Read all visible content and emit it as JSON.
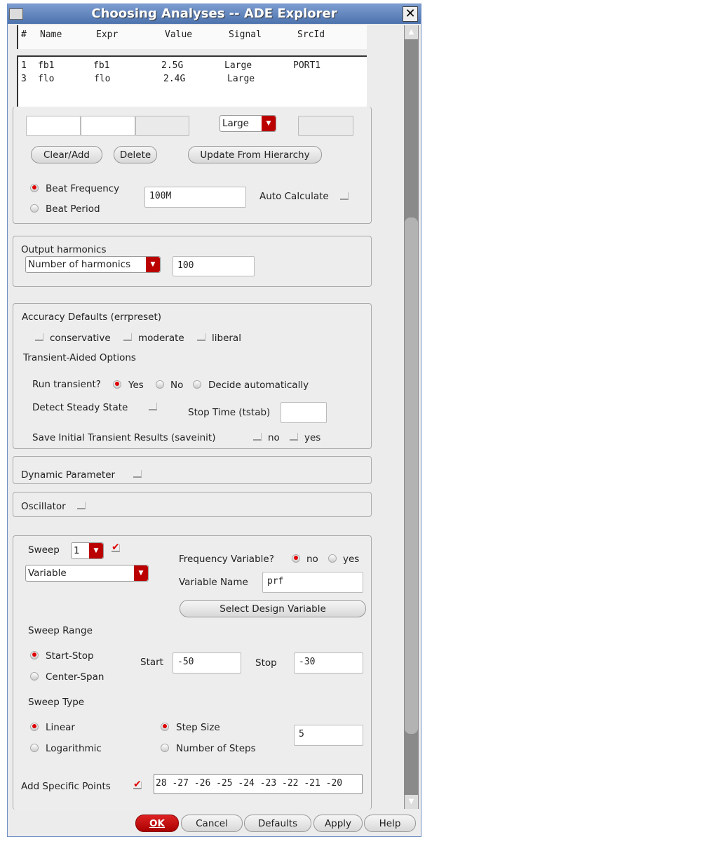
{
  "window": {
    "title": "Choosing Analyses -- ADE Explorer",
    "close": "✕"
  },
  "table": {
    "headers": [
      "#",
      "Name",
      "Expr",
      "Value",
      "Signal",
      "SrcId"
    ],
    "rows": [
      [
        "1",
        "fb1",
        "fb1",
        "2.5G",
        "Large",
        "PORT1"
      ],
      [
        "3",
        "flo",
        "flo",
        "2.4G",
        "Large",
        ""
      ]
    ]
  },
  "edit": {
    "signal": "Large",
    "clear_add": "Clear/Add",
    "delete": "Delete",
    "update": "Update From Hierarchy"
  },
  "beat": {
    "freq_label": "Beat Frequency",
    "period_label": "Beat Period",
    "value": "100M",
    "auto_calc": "Auto Calculate",
    "selected": "Beat Frequency"
  },
  "output": {
    "label": "Output harmonics",
    "mode": "Number of harmonics",
    "value": "100"
  },
  "accuracy": {
    "label": "Accuracy Defaults (errpreset)",
    "options": [
      "conservative",
      "moderate",
      "liberal"
    ],
    "transient_label": "Transient-Aided Options",
    "run_transient": "Run transient?",
    "run_opts": [
      "Yes",
      "No",
      "Decide automatically"
    ],
    "detect": "Detect Steady State",
    "stop_time": "Stop Time (tstab)",
    "stop_value": "",
    "save_init": "Save Initial Transient Results (saveinit)",
    "save_no": "no",
    "save_yes": "yes"
  },
  "dynamic": "Dynamic Parameter",
  "oscillator": "Oscillator",
  "sweep": {
    "label": "Sweep",
    "num": "1",
    "type": "Variable",
    "freq_var": "Frequency Variable?",
    "no": "no",
    "yes": "yes",
    "var_name_label": "Variable Name",
    "var_name": "prf",
    "select_btn": "Select Design Variable",
    "range_label": "Sweep Range",
    "start_stop": "Start-Stop",
    "center_span": "Center-Span",
    "start_label": "Start",
    "start": "-50",
    "stop_label": "Stop",
    "stop": "-30",
    "type_label": "Sweep Type",
    "linear": "Linear",
    "log": "Logarithmic",
    "step_size": "Step Size",
    "num_steps": "Number of Steps",
    "step_value": "5",
    "add_points": "Add Specific Points",
    "points": "28 -27 -26 -25 -24 -23 -22 -21 -20"
  },
  "buttons": {
    "ok": "OK",
    "cancel": "Cancel",
    "defaults": "Defaults",
    "apply": "Apply",
    "help": "Help"
  }
}
